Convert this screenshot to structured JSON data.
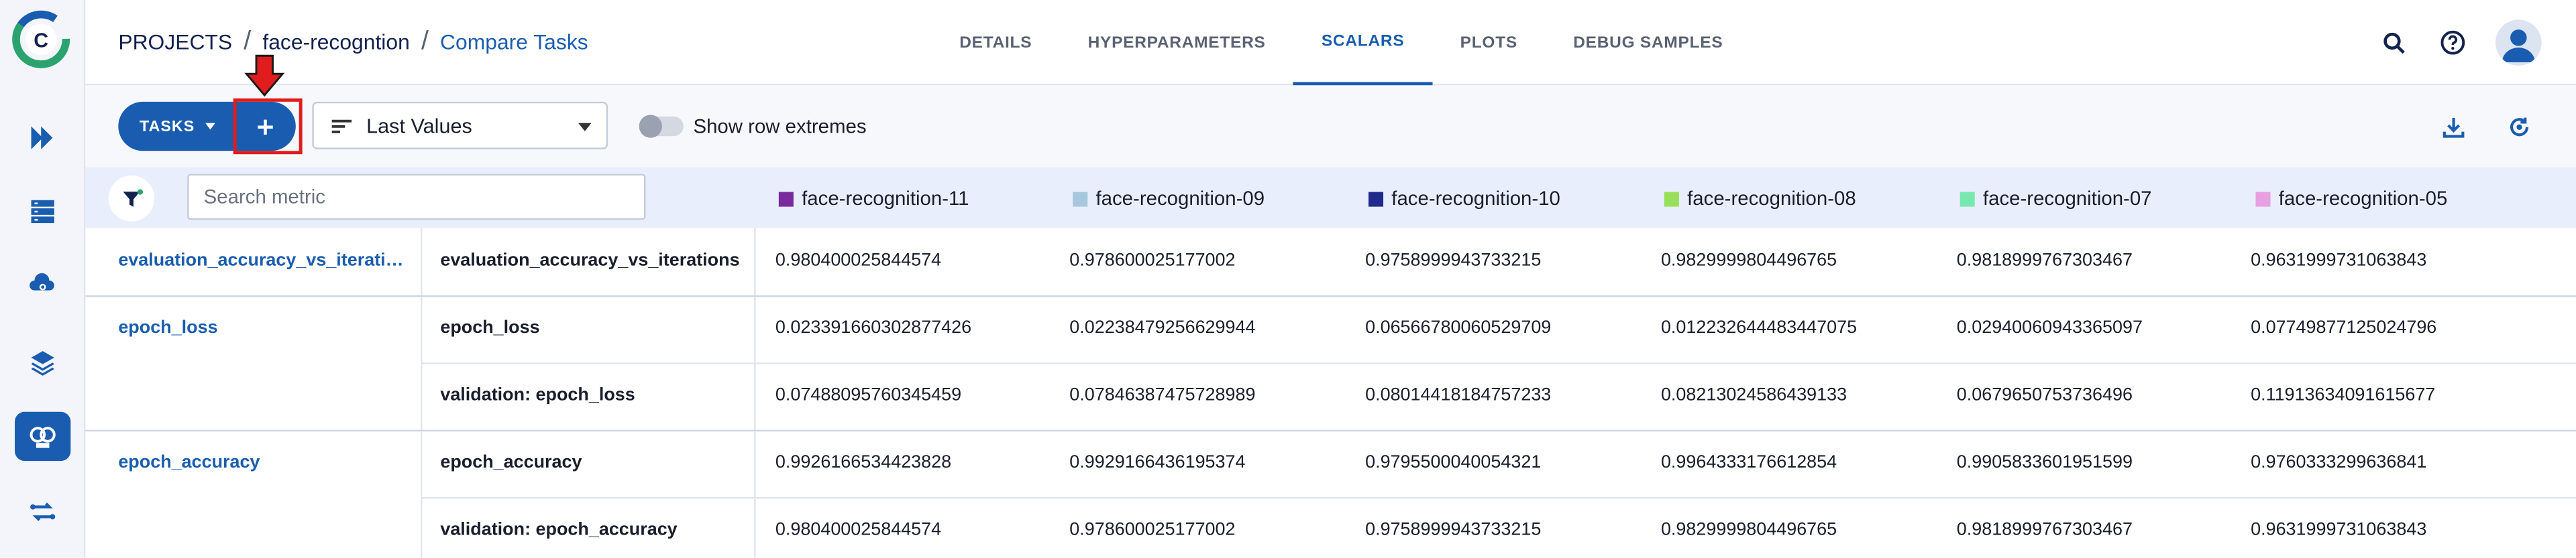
{
  "breadcrumb": {
    "root": "PROJECTS",
    "project": "face-recogntion",
    "page": "Compare Tasks",
    "sep": "/"
  },
  "tabs": [
    "DETAILS",
    "HYPERPARAMETERS",
    "SCALARS",
    "PLOTS",
    "DEBUG SAMPLES"
  ],
  "active_tab": "SCALARS",
  "toolbar": {
    "tasks_label": "TASKS",
    "value_select": "Last Values",
    "toggle_label": "Show row extremes"
  },
  "search": {
    "placeholder": "Search metric"
  },
  "columns": [
    {
      "name": "face-recognition-11",
      "color": "#7b2a9e"
    },
    {
      "name": "face-recognition-09",
      "color": "#a7c7dc"
    },
    {
      "name": "face-recognition-10",
      "color": "#1f2a8c"
    },
    {
      "name": "face-recognition-08",
      "color": "#99e05a"
    },
    {
      "name": "face-recognition-07",
      "color": "#78e8b0"
    },
    {
      "name": "face-recognition-05",
      "color": "#e8a0e0"
    }
  ],
  "rows": [
    {
      "group": "evaluation_accuracy_vs_iteratio...",
      "metric": "evaluation_accuracy_vs_iterations",
      "values": [
        "0.980400025844574",
        "0.978600025177002",
        "0.9758999943733215",
        "0.9829999804496765",
        "0.9818999767303467",
        "0.9631999731063843"
      ]
    },
    {
      "group": "epoch_loss",
      "metric": "epoch_loss",
      "values": [
        "0.023391660302877426",
        "0.02238479256629944",
        "0.06566780060529709",
        "0.012232644483447075",
        "0.02940060943365097",
        "0.07749877125024796"
      ]
    },
    {
      "group": "",
      "metric": "validation: epoch_loss",
      "values": [
        "0.07488095760345459",
        "0.07846387475728989",
        "0.08014418184757233",
        "0.08213024586439133",
        "0.0679650753736496",
        "0.11913634091615677"
      ]
    },
    {
      "group": "epoch_accuracy",
      "metric": "epoch_accuracy",
      "values": [
        "0.9926166534423828",
        "0.9929166436195374",
        "0.9795500040054321",
        "0.9964333176612854",
        "0.9905833601951599",
        "0.9760333299636841"
      ]
    },
    {
      "group": "",
      "metric": "validation: epoch_accuracy",
      "values": [
        "0.980400025844574",
        "0.978600025177002",
        "0.9758999943733215",
        "0.9829999804496765",
        "0.9818999767303467",
        "0.9631999731063843"
      ]
    }
  ],
  "colors": {
    "accent": "#1a5db0",
    "highlight": "#e01c1c"
  }
}
